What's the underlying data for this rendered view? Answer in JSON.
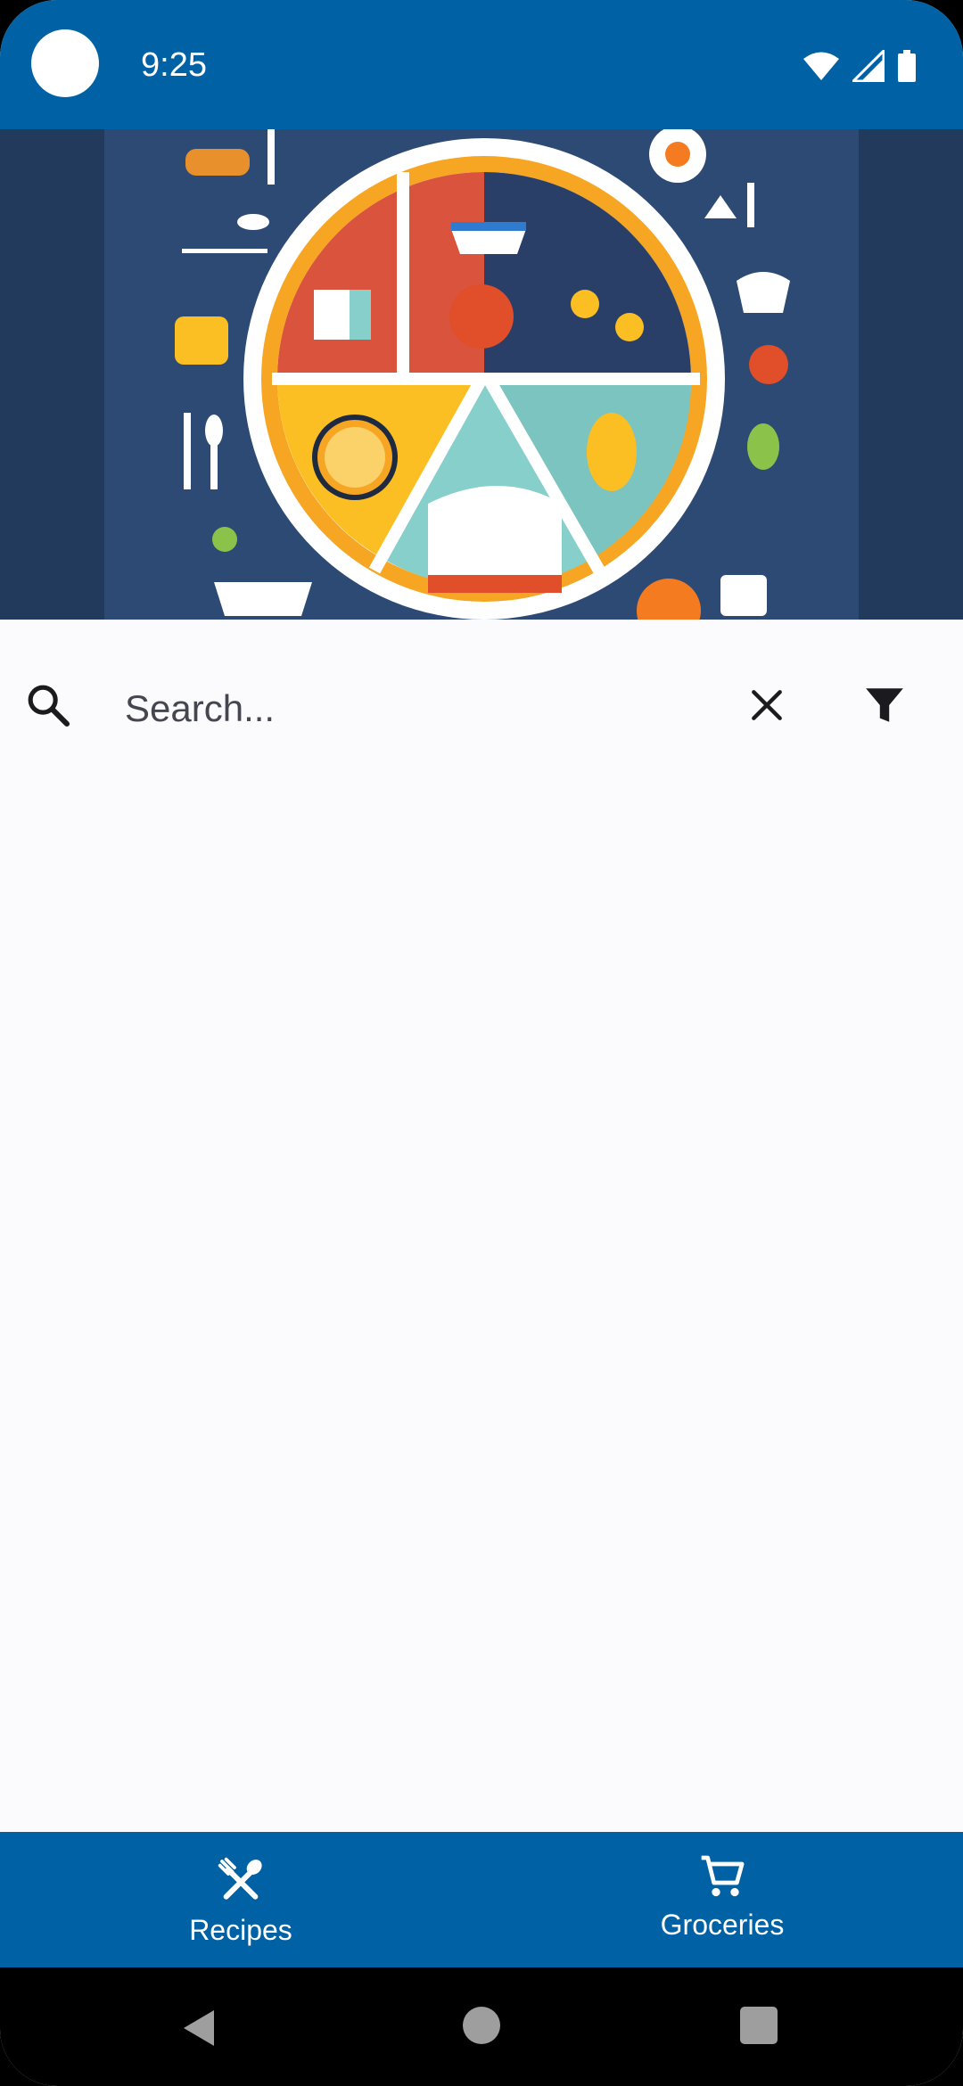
{
  "status_bar": {
    "time": "9:25",
    "icons": [
      "wifi-icon",
      "cell-signal-icon",
      "battery-icon"
    ]
  },
  "hero": {
    "image": "illustrated plate with food icons",
    "colors": {
      "background": "#233a5c",
      "panel": "#2c4a74",
      "orange": "#f4a11c",
      "yellow": "#fbbf24",
      "red": "#d9533d",
      "teal": "#86cfcb"
    }
  },
  "search": {
    "placeholder": "Search...",
    "value": "",
    "icons": {
      "search": "search-icon",
      "clear": "close-icon",
      "filter": "filter-icon"
    }
  },
  "bottom_nav": {
    "items": [
      {
        "label": "Recipes",
        "icon": "fork-spoon-icon"
      },
      {
        "label": "Groceries",
        "icon": "shopping-cart-icon"
      }
    ]
  },
  "system_nav": {
    "icons": [
      "back-icon",
      "home-icon",
      "recents-icon"
    ]
  },
  "colors": {
    "primary": "#0061a4",
    "surface": "#fbfbfe",
    "on_primary": "#ffffff",
    "icon": "#1b1b1f"
  }
}
